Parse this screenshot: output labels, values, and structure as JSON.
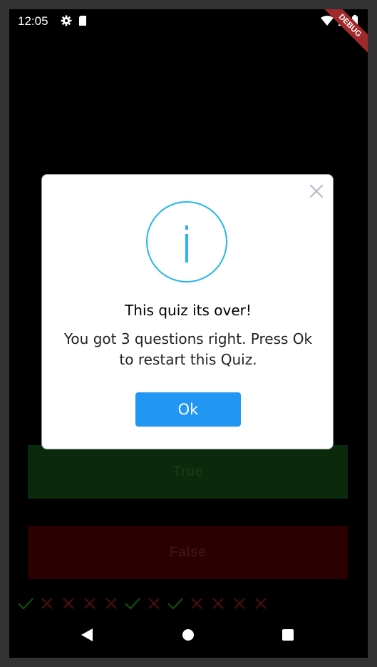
{
  "status_bar": {
    "time": "12:05",
    "debug_label": "DEBUG"
  },
  "quiz": {
    "true_label": "True",
    "false_label": "False"
  },
  "score_marks": [
    "check",
    "cross",
    "cross",
    "cross",
    "cross",
    "check",
    "cross",
    "check",
    "cross",
    "cross",
    "cross",
    "cross"
  ],
  "dialog": {
    "title": "This quiz its over!",
    "message": "You got 3 questions right. Press Ok to restart this Quiz.",
    "ok_label": "Ok",
    "accent_color": "#27b6e8",
    "button_color": "#2196f3"
  },
  "nav": {
    "back_icon": "back-triangle-icon",
    "home_icon": "home-circle-icon",
    "recents_icon": "recents-square-icon"
  }
}
